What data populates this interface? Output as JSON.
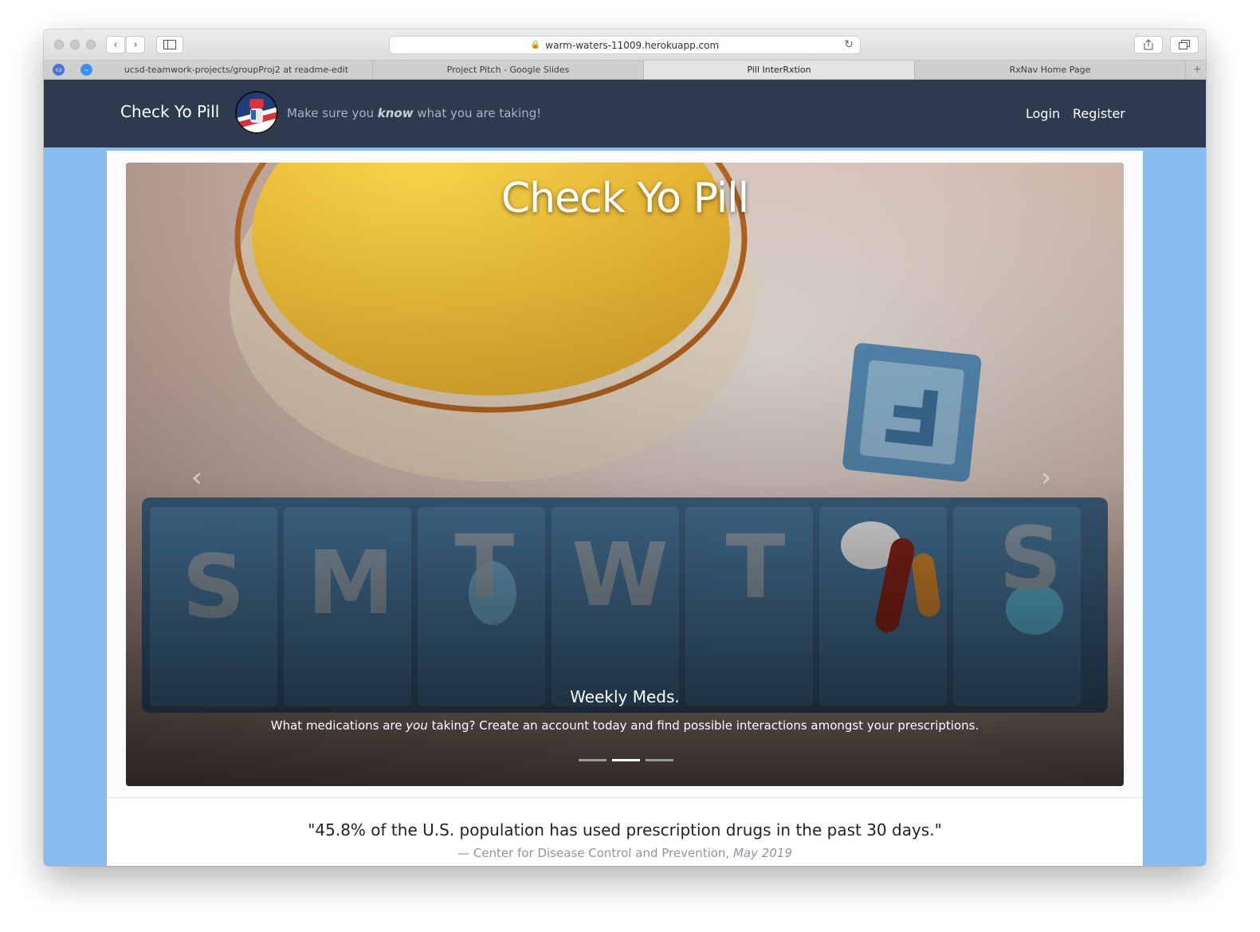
{
  "browser": {
    "url": "warm-waters-11009.herokuapp.com",
    "tabs": [
      {
        "label": "ucsd-teamwork-projects/groupProj2 at readme-edit"
      },
      {
        "label": "Project Pitch - Google Slides"
      },
      {
        "label": "Pill InterRxtion"
      },
      {
        "label": "RxNav Home Page"
      }
    ],
    "new_tab_label": "+"
  },
  "navbar": {
    "brand": "Check Yo Pill",
    "tagline_pre": "Make sure you ",
    "tagline_em": "know",
    "tagline_post": " what you are taking!",
    "login": "Login",
    "register": "Register",
    "background_color": "#2e3b4f"
  },
  "carousel": {
    "title": "Check Yo Pill",
    "prev_icon": "chevron-left-icon",
    "next_icon": "chevron-right-icon",
    "slide": {
      "heading": "Weekly Meds.",
      "text_pre": "What medications are ",
      "text_em": "you",
      "text_post": " taking? Create an account today and find possible interactions amongst your prescriptions.",
      "pillbox_letters": [
        "S",
        "M",
        "T",
        "W",
        "T",
        "F",
        "S"
      ]
    },
    "slide_count": 3,
    "active_slide": 2
  },
  "quote": {
    "text": "\"45.8% of the U.S. population has used prescription drugs in the past 30 days.\"",
    "source": "— Center for Disease Control and Prevention, ",
    "date": "May 2019"
  },
  "colors": {
    "page_background": "#86bdee",
    "accent_red": "#d3343d"
  }
}
